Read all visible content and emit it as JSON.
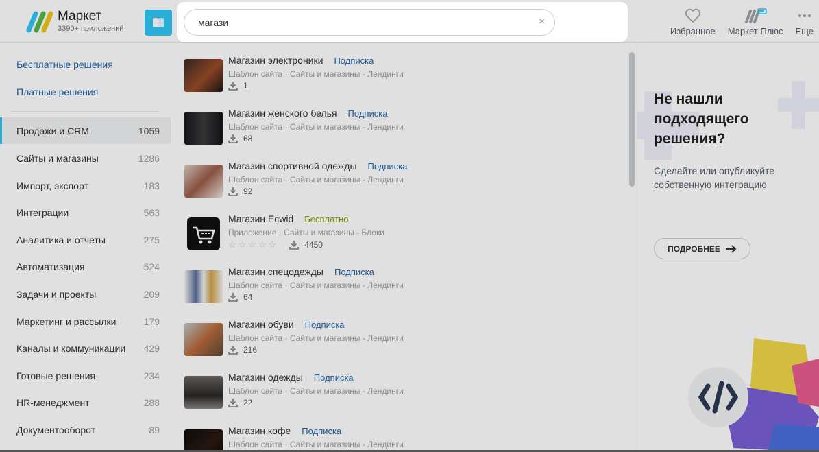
{
  "header": {
    "brand_name": "Маркет",
    "brand_sub": "3390+ приложений",
    "actions": [
      {
        "label": "Избранное",
        "icon": "heart-icon"
      },
      {
        "label": "Маркет Плюс",
        "icon": "market-plus-icon"
      },
      {
        "label": "Еще",
        "icon": "more-icon"
      }
    ]
  },
  "search": {
    "value": "магази",
    "clear_icon": "×"
  },
  "sidebar": {
    "links": [
      "Бесплатные решения",
      "Платные решения"
    ],
    "categories": [
      {
        "label": "Продажи и CRM",
        "count": "1059"
      },
      {
        "label": "Сайты и магазины",
        "count": "1286"
      },
      {
        "label": "Импорт, экспорт",
        "count": "183"
      },
      {
        "label": "Интеграции",
        "count": "563"
      },
      {
        "label": "Аналитика и отчеты",
        "count": "275"
      },
      {
        "label": "Автоматизация",
        "count": "524"
      },
      {
        "label": "Задачи и проекты",
        "count": "209"
      },
      {
        "label": "Маркетинг и рассылки",
        "count": "179"
      },
      {
        "label": "Каналы и коммуникации",
        "count": "429"
      },
      {
        "label": "Готовые решения",
        "count": "234"
      },
      {
        "label": "HR-менеджмент",
        "count": "288"
      },
      {
        "label": "Документооборот",
        "count": "89"
      }
    ]
  },
  "results": [
    {
      "title": "Магазин электроники",
      "tag": "Подписка",
      "sub": "Шаблон сайта · Сайты и магазины - Лендинги",
      "installs": "1"
    },
    {
      "title": "Магазин женского белья",
      "tag": "Подписка",
      "sub": "Шаблон сайта · Сайты и магазины - Лендинги",
      "installs": "68"
    },
    {
      "title": "Магазин спортивной одежды",
      "tag": "Подписка",
      "sub": "Шаблон сайта · Сайты и магазины - Лендинги",
      "installs": "92"
    },
    {
      "title": "Магазин Ecwid",
      "tag": "Бесплатно",
      "sub": "Приложение · Сайты и магазины - Блоки",
      "installs": "4450",
      "stars": "☆☆☆☆☆"
    },
    {
      "title": "Магазин спецодежды",
      "tag": "Подписка",
      "sub": "Шаблон сайта · Сайты и магазины - Лендинги",
      "installs": "64"
    },
    {
      "title": "Магазин обуви",
      "tag": "Подписка",
      "sub": "Шаблон сайта · Сайты и магазины - Лендинги",
      "installs": "216"
    },
    {
      "title": "Магазин одежды",
      "tag": "Подписка",
      "sub": "Шаблон сайта · Сайты и магазины - Лендинги",
      "installs": "22"
    },
    {
      "title": "Магазин кофе",
      "tag": "Подписка",
      "sub": "Шаблон сайта · Сайты и магазины - Лендинги",
      "installs": ""
    }
  ],
  "promo": {
    "title": "Не нашли подходящего решения?",
    "text": "Сделайте или опубликуйте собственную интеграцию",
    "button": "ПОДРОБНЕЕ"
  },
  "colors": {
    "accent": "#2fc6f6",
    "link": "#2067b0",
    "free": "#7aa400"
  }
}
